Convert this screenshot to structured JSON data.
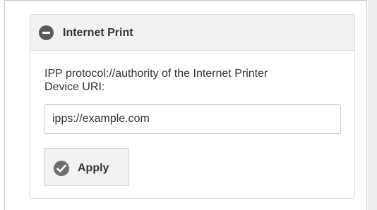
{
  "section": {
    "title": "Internet Print",
    "collapse_icon": "minus-circle-icon"
  },
  "device_uri": {
    "label_line1": "IPP protocol://authority of the Internet Printer",
    "label_line2": "Device URI:",
    "value": "ipps://example.com"
  },
  "actions": {
    "apply_label": "Apply",
    "apply_icon": "check-circle-icon"
  },
  "colors": {
    "header_bg": "#f2f2f2",
    "border": "#dcdcdc",
    "text": "#333333",
    "icon": "#5a5a5a"
  }
}
